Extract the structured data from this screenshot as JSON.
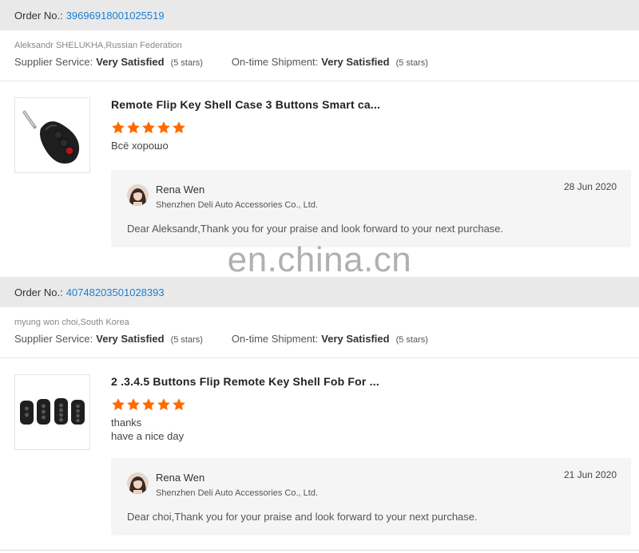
{
  "orders": [
    {
      "order_label": "Order No.:",
      "order_number": "39696918001025519",
      "buyer": "Aleksandr SHELUKHA,Russian Federation",
      "supplier_label": "Supplier Service:",
      "supplier_value": "Very Satisfied",
      "supplier_stars": "(5 stars)",
      "shipment_label": "On-time Shipment:",
      "shipment_value": "Very Satisfied",
      "shipment_stars": "(5 stars)",
      "product_title": "Remote Flip Key Shell Case 3 Buttons Smart ca...",
      "rating": 5,
      "review_line1": "Всё хорошо",
      "review_line2": "",
      "reply": {
        "name": "Rena Wen",
        "company": "Shenzhen Deli Auto Accessories Co., Ltd.",
        "date": "28 Jun 2020",
        "text": "Dear Aleksandr,Thank you for your praise and look forward to your next purchase."
      }
    },
    {
      "order_label": "Order No.:",
      "order_number": "40748203501028393",
      "buyer": "myung won choi,South Korea",
      "supplier_label": "Supplier Service:",
      "supplier_value": "Very Satisfied",
      "supplier_stars": "(5 stars)",
      "shipment_label": "On-time Shipment:",
      "shipment_value": "Very Satisfied",
      "shipment_stars": "(5 stars)",
      "product_title": "2 .3.4.5 Buttons Flip Remote Key Shell Fob For ...",
      "rating": 5,
      "review_line1": "thanks",
      "review_line2": "have a nice day",
      "reply": {
        "name": "Rena Wen",
        "company": "Shenzhen Deli Auto Accessories Co., Ltd.",
        "date": "21 Jun 2020",
        "text": "Dear choi,Thank you for your praise and look forward to your next purchase."
      }
    }
  ],
  "watermark": "en.china.cn",
  "colors": {
    "star": "#ff6a00",
    "link": "#1a7fd4",
    "header_bg": "#e9e9e9",
    "reply_bg": "#f5f5f5"
  },
  "icons": {
    "star": "star-icon",
    "avatar": "avatar-image",
    "product": "car-key-image"
  }
}
